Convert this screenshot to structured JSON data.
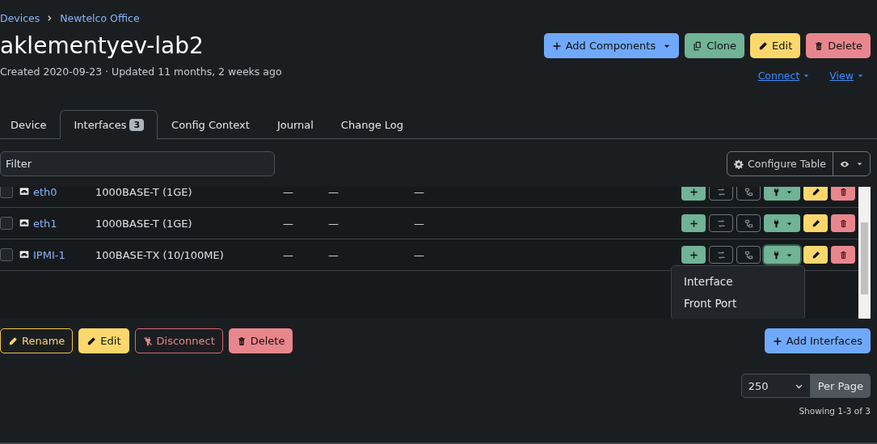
{
  "breadcrumbs": [
    "Devices",
    "Newtelco Office"
  ],
  "title": "aklementyev-lab2",
  "meta": "Created 2020-09-23 · Updated 11 months, 2 weeks ago",
  "actions": [
    {
      "label": "Add Components",
      "kind": "add",
      "caret": true
    },
    {
      "label": "Clone",
      "kind": "clone",
      "caret": false
    },
    {
      "label": "Edit",
      "kind": "edit",
      "caret": false
    },
    {
      "label": "Delete",
      "kind": "delete",
      "caret": false
    }
  ],
  "links": [
    "Connect",
    "View"
  ],
  "tabs": [
    {
      "label": "Device",
      "selected": false
    },
    {
      "label": "Interfaces",
      "badge": "3",
      "selected": true
    },
    {
      "label": "Config Context",
      "selected": false
    },
    {
      "label": "Journal",
      "selected": false
    },
    {
      "label": "Change Log",
      "selected": false
    }
  ],
  "filter": {
    "placeholder": "Filter"
  },
  "configure_button": "Configure Table",
  "table": {
    "rows": [
      {
        "name": "eth0",
        "type": "1000BASE-T (1GE)",
        "column_3": "—",
        "column_4": "—",
        "column_5": "—",
        "checked": false,
        "menu_open": false
      },
      {
        "name": "eth1",
        "type": "1000BASE-T (1GE)",
        "column_3": "—",
        "column_4": "—",
        "column_5": "—",
        "checked": false,
        "menu_open": false
      },
      {
        "name": "IPMI-1",
        "type": "100BASE-TX (10/100ME)",
        "column_3": "—",
        "column_4": "—",
        "column_5": "—",
        "checked": false,
        "menu_open": true
      }
    ]
  },
  "dropdown": {
    "items": [
      "Interface",
      "Front Port"
    ]
  },
  "bulk_buttons": [
    {
      "label": "Rename",
      "kind": "rename"
    },
    {
      "label": "Edit",
      "kind": "edit"
    },
    {
      "label": "Disconnect",
      "kind": "disconnect"
    },
    {
      "label": "Delete",
      "kind": "delete"
    }
  ],
  "add_button": "Add Interfaces",
  "per_page": {
    "value": "250",
    "label": "Per Page"
  },
  "showing": "Showing 1-3 of 3"
}
